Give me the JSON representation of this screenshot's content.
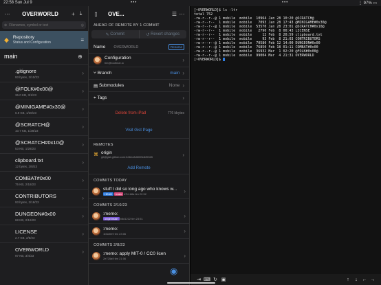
{
  "status": {
    "time": "22:58",
    "date": "Sun Jul 9",
    "battery": "97%"
  },
  "sidebar": {
    "title": "OVERWORLD",
    "search_placeholder": "Filenames, symbol or text",
    "repo": {
      "title": "Repository",
      "subtitle": "Status and Configuration"
    },
    "branch": "main",
    "files": [
      {
        "name": ".gitignore",
        "meta": "93 bytes, 2/10/23"
      },
      {
        "name": "@FOLK#0x00@",
        "meta": "36.0 KB, 3/1/23"
      },
      {
        "name": "@MINIGAME#0x30@",
        "meta": "6.9 KB, 1/28/23"
      },
      {
        "name": "@SCRATCH@",
        "meta": "10.7 KB, 1/28/23"
      },
      {
        "name": "@SCRATCH#0x10@",
        "meta": "53 KB, 1/28/23"
      },
      {
        "name": "clipboard.txt",
        "meta": "12 bytes, 2/8/23"
      },
      {
        "name": "COMBAT#0x00",
        "meta": "75 KB, 2/18/23"
      },
      {
        "name": "CONTRIBUTORS",
        "meta": "93 bytes, 2/18/23"
      },
      {
        "name": "DUNGEON#0x00",
        "meta": "68 KB, 2/12/23"
      },
      {
        "name": "LICENSE",
        "meta": "2.7 KB, 2/8/23"
      },
      {
        "name": "OVERWORLD",
        "meta": "97 KB, 3/4/23"
      }
    ]
  },
  "middle": {
    "title": "OVE...",
    "ahead_label": "AHEAD OF REMOTE BY 1 COMMIT",
    "commit_btn": "Commit",
    "revert_btn": "Revert changes",
    "name_label": "Name",
    "name_value": "OVERWORLD",
    "rename_btn": "Rename",
    "config_label": "Configuration",
    "config_sub": "tim@toolbear.io",
    "branch_label": "Branch",
    "branch_value": "main",
    "submodules_label": "Submodules",
    "submodules_value": "None",
    "tags_label": "Tags",
    "delete_label": "Delete from iPad",
    "size": "776 kbytes",
    "visit_label": "Visit Gist Page",
    "remotes_label": "REMOTES",
    "remote_name": "origin",
    "remote_url": "git@gist.github.com:646ec8d6005db9f465",
    "add_remote": "Add Remote",
    "sections": [
      {
        "label": "COMMITS TODAY",
        "commits": [
          {
            "msg": "stuff I did so long ago who knows w...",
            "tags": [
              "HEAD",
              "main"
            ],
            "meta": "d7b1b8a tim 22:52"
          }
        ]
      },
      {
        "label": "COMMITS 2/10/23",
        "commits": [
          {
            "msg": ":memo:",
            "tags": [
              "origin/main"
            ],
            "meta": "b8d1222 tim 23:51"
          },
          {
            "msg": ":memo:",
            "tags": [],
            "meta": "1b6d0e9 tim 23:06"
          }
        ]
      },
      {
        "label": "COMMITS 2/8/23",
        "commits": [
          {
            "msg": ":memo: apply MIT-0 / CC0 licen",
            "tags": [],
            "meta": "2e725a9 tim 21:06"
          }
        ]
      }
    ]
  },
  "terminal": {
    "lines": [
      "[~OVERWORLD]$ ls -ltr",
      "total 752",
      "-rw-r--r--@ 1 mobile  mobile  10964 Jan 28 10:20 @SCRATCH@",
      "-rw-r--r--  1 mobile  mobile   7093 Jan 28 17:43 @MINIGAME#0x30@",
      "-rw-r--r--@ 1 mobile  mobile  53570 Jan 28 23:01 @SCRATCH#0x10@",
      "-rw-r--r--  1 mobile  mobile   2790 Feb  8 00:43 LICENSE",
      "-rw-r--r--  1 mobile  mobile     12 Feb  8 20:59 clipboard.txt",
      "-rw-r--r--  1 mobile  mobile     93 Feb  8 21:03 CONTRIBUTORS",
      "-rw-r--r--@ 1 mobile  mobile  70580 Feb 12 14:00 DUNGEON#0x00",
      "-rw-r--r--@ 1 mobile  mobile  76850 Feb 18 01:11 COMBAT#0x00",
      "-rw-r--r--@ 1 mobile  mobile  36932 Mar  1 02:20 @FOLK#0x00@",
      "-rw-r--r--@ 1 mobile  mobile  99004 Mar  4 21:31 OVERWORLD",
      "[~OVERWORLD]$ "
    ]
  },
  "colors": {
    "accent": "#4a90e2",
    "danger": "#e0453a",
    "selected": "#3c5060",
    "head_tag": "#2f7de1",
    "main_tag": "#d64a7a"
  }
}
